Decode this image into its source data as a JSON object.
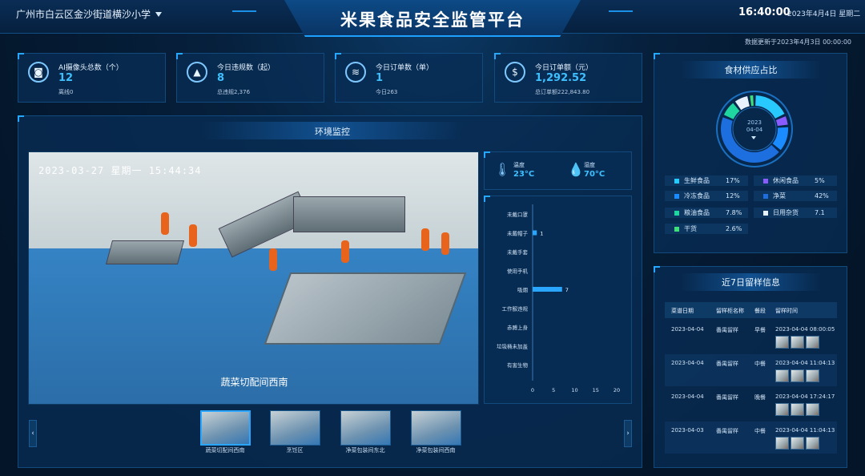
{
  "header": {
    "location": "广州市白云区金沙街道横沙小学",
    "title": "米果食品安全监管平台",
    "time": "16:40:00",
    "date": "2023年4月4日 星期二",
    "update": "数据更新于2023年4月3日 00:00:00"
  },
  "stats": [
    {
      "icon": "camera-icon",
      "label": "AI摄像头总数（个）",
      "value": "12",
      "sub": "离线0"
    },
    {
      "icon": "warning-icon",
      "label": "今日违规数（起）",
      "value": "8",
      "sub": "总违规2,376"
    },
    {
      "icon": "layers-icon",
      "label": "今日订单数（单）",
      "value": "1",
      "sub": "今日263"
    },
    {
      "icon": "dollar-icon",
      "label": "今日订单额（元）",
      "value": "1,292.52",
      "sub": "总订单额222,843.80"
    }
  ],
  "monitor": {
    "title": "环境监控",
    "stamp": "2023-03-27 星期一 15:44:34",
    "caption": "蔬菜切配间西南",
    "temp_label": "温度",
    "temp": "23°C",
    "hum_label": "湿度",
    "hum": "70°C",
    "thumbs": [
      "蔬菜切配间西南",
      "烹饪区",
      "净菜包装间东北",
      "净菜包装间西南"
    ],
    "prev": "‹",
    "next": "›"
  },
  "chart_data": {
    "type": "bar",
    "orientation": "horizontal",
    "categories": [
      "未戴口罩",
      "未戴帽子",
      "未戴手套",
      "使用手机",
      "吸烟",
      "工作服违规",
      "赤膊上身",
      "垃圾桶未加盖",
      "有害生物"
    ],
    "values": [
      0,
      1,
      0,
      0,
      7,
      0,
      0,
      0,
      0
    ],
    "xlim": [
      0,
      20
    ],
    "xticks": [
      "0",
      "5",
      "10",
      "15",
      "20"
    ],
    "bar_color": "#2aa6ff"
  },
  "supply": {
    "title": "食材供应占比",
    "center_year": "2023",
    "center_date": "04-04",
    "items": [
      {
        "name": "生鲜食品",
        "pct": "17%",
        "color": "#28c9ff"
      },
      {
        "name": "休闲食品",
        "pct": "5%",
        "color": "#8a5cff"
      },
      {
        "name": "冷冻食品",
        "pct": "12%",
        "color": "#1a8cff"
      },
      {
        "name": "净菜",
        "pct": "42%",
        "color": "#1d6fe0"
      },
      {
        "name": "粮油食品",
        "pct": "7.8%",
        "color": "#1fd6a0"
      },
      {
        "name": "日用杂货",
        "pct": "7.1",
        "color": "#e8f2ff"
      },
      {
        "name": "干货",
        "pct": "2.6%",
        "color": "#3ee07a"
      }
    ]
  },
  "samples": {
    "title": "近7日留样信息",
    "headers": [
      "菜谱日期",
      "留样柜名称",
      "餐段",
      "留样时间"
    ],
    "rows": [
      {
        "date": "2023-04-04",
        "cabinet": "番禺留样",
        "meal": "早餐",
        "time": "2023-04-04 08:00:05"
      },
      {
        "date": "2023-04-04",
        "cabinet": "番禺留样",
        "meal": "中餐",
        "time": "2023-04-04 11:04:13"
      },
      {
        "date": "2023-04-04",
        "cabinet": "番禺留样",
        "meal": "晚餐",
        "time": "2023-04-04 17:24:17"
      },
      {
        "date": "2023-04-03",
        "cabinet": "番禺留样",
        "meal": "中餐",
        "time": "2023-04-04 11:04:13"
      }
    ]
  }
}
